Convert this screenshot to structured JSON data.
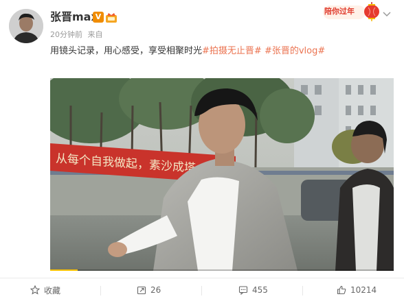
{
  "user": {
    "name": "张晋max",
    "vip_label": "V",
    "time": "20分钟前",
    "source_prefix": "来自"
  },
  "festival": {
    "text": "陪你过年"
  },
  "post": {
    "body": "用镜头记录，用心感受，享受相聚时光",
    "tags": [
      "#拍摄无止晋#",
      "#张晋的vlog#"
    ]
  },
  "video": {
    "progress_fraction": 0.08,
    "banner_text": "从每个自我做起，素沙成塔",
    "colors": {
      "progress": "#ffc300",
      "banner": "#c9332b"
    }
  },
  "actions": {
    "collect": {
      "label": "收藏",
      "icon": "star-icon"
    },
    "repost": {
      "count": "26",
      "icon": "repost-icon"
    },
    "comment": {
      "count": "455",
      "icon": "comment-icon"
    },
    "like": {
      "count": "10214",
      "icon": "thumb-up-icon"
    }
  },
  "colors": {
    "tag": "#eb7350",
    "festival": "#e03c2e"
  }
}
